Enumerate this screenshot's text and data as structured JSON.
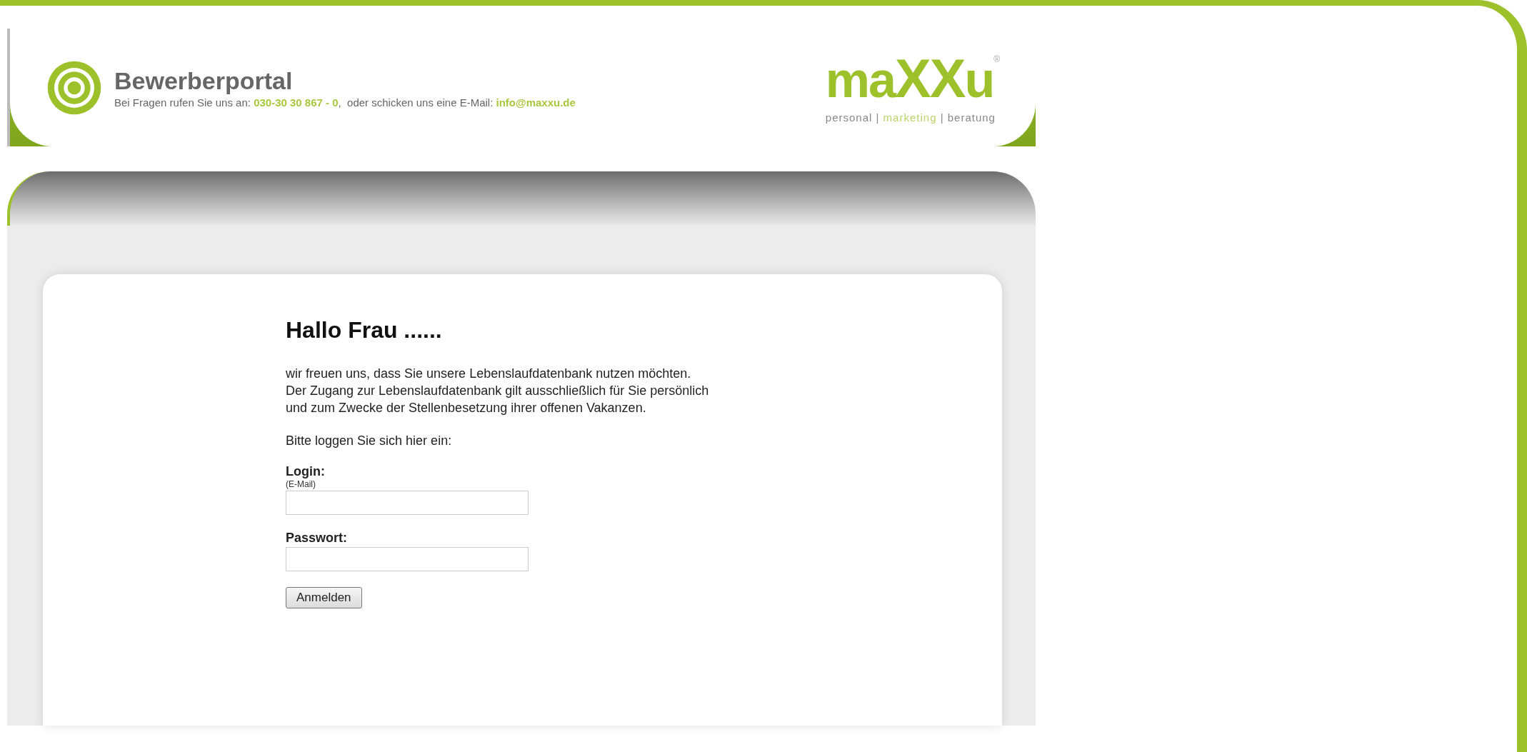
{
  "header": {
    "title": "Bewerberportal",
    "contact": {
      "before": "Bei Fragen rufen Sie uns an:",
      "phone": "030-30 30 867 - 0",
      "middle": ",  oder schicken uns eine E-Mail:",
      "email": "info@maxxu.de"
    }
  },
  "logo": {
    "parts": [
      {
        "text": "ma",
        "kind": "plain"
      },
      {
        "text": "XX",
        "kind": "bold"
      },
      {
        "text": "u",
        "kind": "plain"
      }
    ],
    "mark": "®",
    "tagline": [
      {
        "text": "personal",
        "highlight": false
      },
      {
        "text": " | ",
        "highlight": false
      },
      {
        "text": "marketing",
        "highlight": true
      },
      {
        "text": " | beratung",
        "highlight": false
      }
    ]
  },
  "login": {
    "heading": "Hallo Frau ......",
    "intro": [
      "wir freuen uns, dass Sie unsere Lebenslaufdatenbank nutzen möchten.",
      "Der Zugang zur Lebenslaufdatenbank gilt ausschließlich für Sie persönlich und zum Zwecke der Stellenbesetzung ihrer offenen Vakanzen."
    ],
    "prompt": "Bitte loggen Sie sich hier ein:",
    "fields": [
      {
        "label": "Login:",
        "hint": "(E-Mail)"
      },
      {
        "label": "Passwort:"
      }
    ],
    "button": "Anmelden"
  }
}
